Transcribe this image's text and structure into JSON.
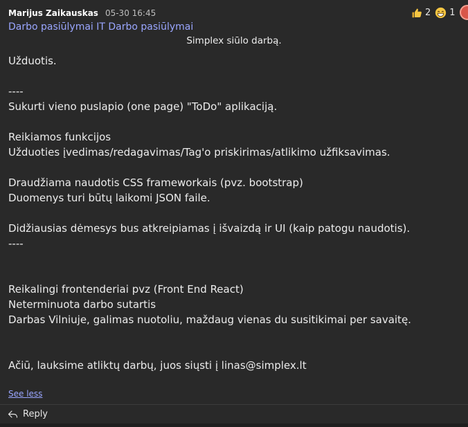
{
  "post": {
    "author": "Marijus Zaikauskas",
    "timestamp": "05-30 16:45",
    "subject": "Darbo pasiūlymai IT Darbo pasiūlymai",
    "intro": "Simplex siūlo darbą.",
    "lines": {
      "l1": "Užduotis.",
      "l2": "----",
      "l3": "Sukurti vieno puslapio (one page) \"ToDo\" aplikaciją.",
      "l4": "Reikiamos funkcijos",
      "l5": "Užduoties įvedimas/redagavimas/Tag'o priskirimas/atlikimo užfiksavimas.",
      "l6": "Draudžiama naudotis CSS frameworkais (pvz. bootstrap)",
      "l7": "Duomenys turi būtų laikomi JSON faile.",
      "l8": "Didžiausias dėmesys bus atkreipiamas į išvaizdą ir UI (kaip patogu naudotis).",
      "l9": "----",
      "l10": "Reikalingi frontenderiai pvz (Front End React)",
      "l11": "Neterminuota darbo sutartis",
      "l12": "Darbas Vilniuje, galimas nuotoliu, maždaug vienas du susitikimai per savaitę.",
      "l13": "Ačiū, lauksime atliktų darbų, juos siųsti į linas@simplex.lt"
    },
    "see_less": "See less",
    "reply_label": "Reply"
  },
  "reactions": [
    {
      "icon": "thumbs-up-icon",
      "count": "2"
    },
    {
      "icon": "laughing-face-icon",
      "count": "1"
    }
  ],
  "colors": {
    "background": "#292929",
    "link": "#9aa6ff",
    "text": "#ececec",
    "reaction_yellow": "#f5c542"
  }
}
